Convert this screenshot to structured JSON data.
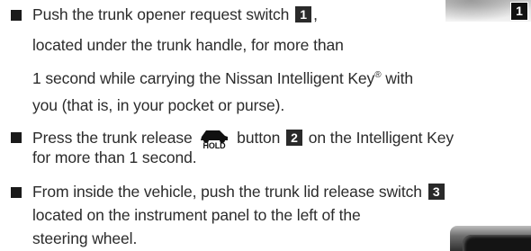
{
  "figure_1": {
    "callout": "1",
    "icon": "trunk-opener-switch-photo"
  },
  "figure_2": {
    "icon": "instrument-panel-photo"
  },
  "items": [
    {
      "lines": [
        [
          "Push the trunk opener request switch ",
          "1",
          ","
        ],
        [
          "located under the trunk handle, for more than"
        ],
        [
          "1 second while carrying the Nissan Intelligent Key",
          "®",
          " with"
        ],
        [
          "you (that is, in your pocket or purse)."
        ]
      ]
    },
    {
      "lines": [
        [
          "Press the trunk release ",
          "HOLD",
          " button ",
          "2",
          " on the Intelligent Key"
        ],
        [
          "for more than 1 second."
        ]
      ]
    },
    {
      "lines": [
        [
          "From inside the vehicle, push the trunk lid release switch ",
          "3"
        ],
        [
          "located on the instrument panel to the left of the"
        ],
        [
          "steering wheel."
        ]
      ]
    }
  ],
  "icons": {
    "trunk_release": "car-trunk-hold-icon",
    "bullet": "square-bullet-icon"
  }
}
